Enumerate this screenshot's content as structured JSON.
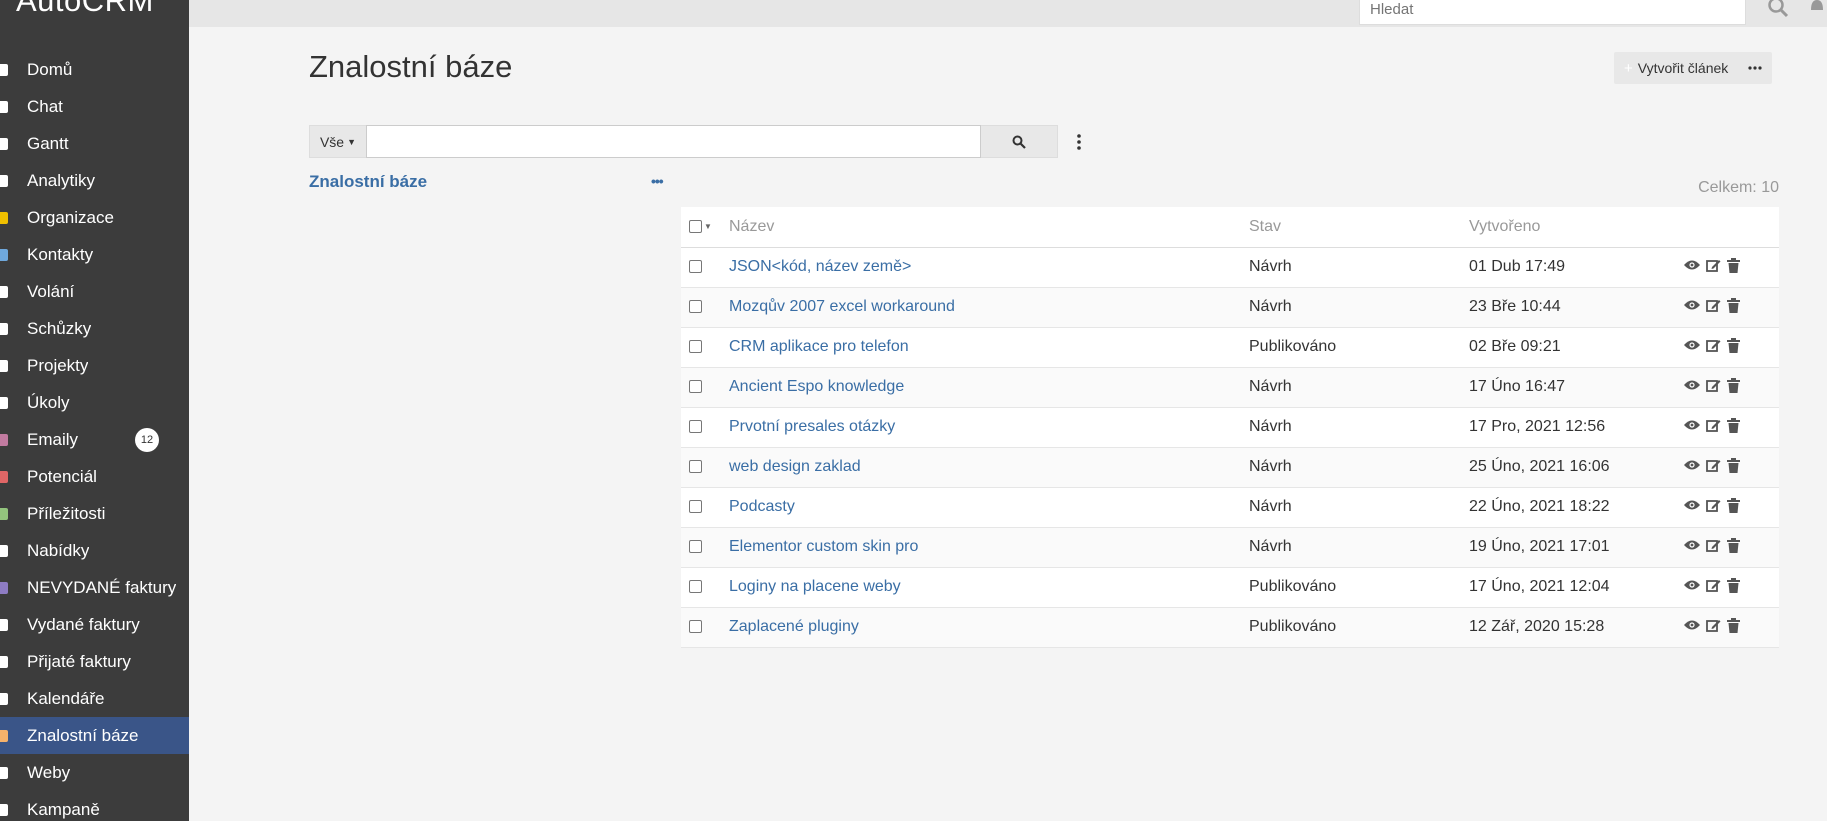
{
  "app": {
    "brand": "AutoCRM"
  },
  "sidebar": {
    "items": [
      {
        "label": "Domů",
        "icon": "home-icon",
        "color": "#ffffff"
      },
      {
        "label": "Chat",
        "icon": "chat-icon",
        "color": "#ffffff"
      },
      {
        "label": "Gantt",
        "icon": "gantt-icon",
        "color": "#ffffff"
      },
      {
        "label": "Analytiky",
        "icon": "analytics-icon",
        "color": "#ffffff"
      },
      {
        "label": "Organizace",
        "icon": "building-icon",
        "color": "#f0c000"
      },
      {
        "label": "Kontakty",
        "icon": "contacts-icon",
        "color": "#6fa8dc"
      },
      {
        "label": "Volání",
        "icon": "phone-icon",
        "color": "#ffffff"
      },
      {
        "label": "Schůzky",
        "icon": "calendar-icon",
        "color": "#ffffff"
      },
      {
        "label": "Projekty",
        "icon": "projects-icon",
        "color": "#ffffff"
      },
      {
        "label": "Úkoly",
        "icon": "tasks-icon",
        "color": "#ffffff"
      },
      {
        "label": "Emaily",
        "icon": "email-icon",
        "color": "#c27ba0",
        "badge": "12"
      },
      {
        "label": "Potenciál",
        "icon": "lead-icon",
        "color": "#e06666"
      },
      {
        "label": "Příležitosti",
        "icon": "dollar-icon",
        "color": "#93c47d"
      },
      {
        "label": "Nabídky",
        "icon": "quote-icon",
        "color": "#ffffff"
      },
      {
        "label": "NEVYDANÉ faktury",
        "icon": "invoice-icon",
        "color": "#8e7cc3"
      },
      {
        "label": "Vydané faktury",
        "icon": "invoice-out-icon",
        "color": "#ffffff"
      },
      {
        "label": "Přijaté faktury",
        "icon": "invoice-in-icon",
        "color": "#ffffff"
      },
      {
        "label": "Kalendáře",
        "icon": "calendar-icon",
        "color": "#ffffff"
      },
      {
        "label": "Znalostní báze",
        "icon": "book-icon",
        "color": "#f6b26b",
        "active": true
      },
      {
        "label": "Weby",
        "icon": "globe-icon",
        "color": "#ffffff"
      },
      {
        "label": "Kampaně",
        "icon": "campaign-icon",
        "color": "#ffffff"
      }
    ]
  },
  "topbar": {
    "search_placeholder": "Hledat"
  },
  "page": {
    "title": "Znalostní báze",
    "create_label": "Vytvořit článek"
  },
  "filter": {
    "scope_label": "Vše"
  },
  "category": {
    "title": "Znalostní báze",
    "more": "•••"
  },
  "total": {
    "label": "Celkem:",
    "count": "10"
  },
  "table": {
    "headers": {
      "name": "Název",
      "status": "Stav",
      "created": "Vytvořeno"
    },
    "rows": [
      {
        "name": "JSON<kód, název země>",
        "status": "Návrh",
        "created": "01 Dub 17:49"
      },
      {
        "name": "Mozqův 2007 excel workaround",
        "status": "Návrh",
        "created": "23 Bře 10:44"
      },
      {
        "name": "CRM aplikace pro telefon",
        "status": "Publikováno",
        "created": "02 Bře 09:21"
      },
      {
        "name": "Ancient Espo knowledge",
        "status": "Návrh",
        "created": "17 Úno 16:47"
      },
      {
        "name": "Prvotní presales otázky",
        "status": "Návrh",
        "created": "17 Pro, 2021 12:56"
      },
      {
        "name": "web design zaklad",
        "status": "Návrh",
        "created": "25 Úno, 2021 16:06"
      },
      {
        "name": "Podcasty",
        "status": "Návrh",
        "created": "22 Úno, 2021 18:22"
      },
      {
        "name": "Elementor custom skin pro",
        "status": "Návrh",
        "created": "19 Úno, 2021 17:01"
      },
      {
        "name": "Loginy na placene weby",
        "status": "Publikováno",
        "created": "17 Úno, 2021 12:04"
      },
      {
        "name": "Zaplacené pluginy",
        "status": "Publikováno",
        "created": "12 Zář, 2020 15:28"
      }
    ]
  }
}
